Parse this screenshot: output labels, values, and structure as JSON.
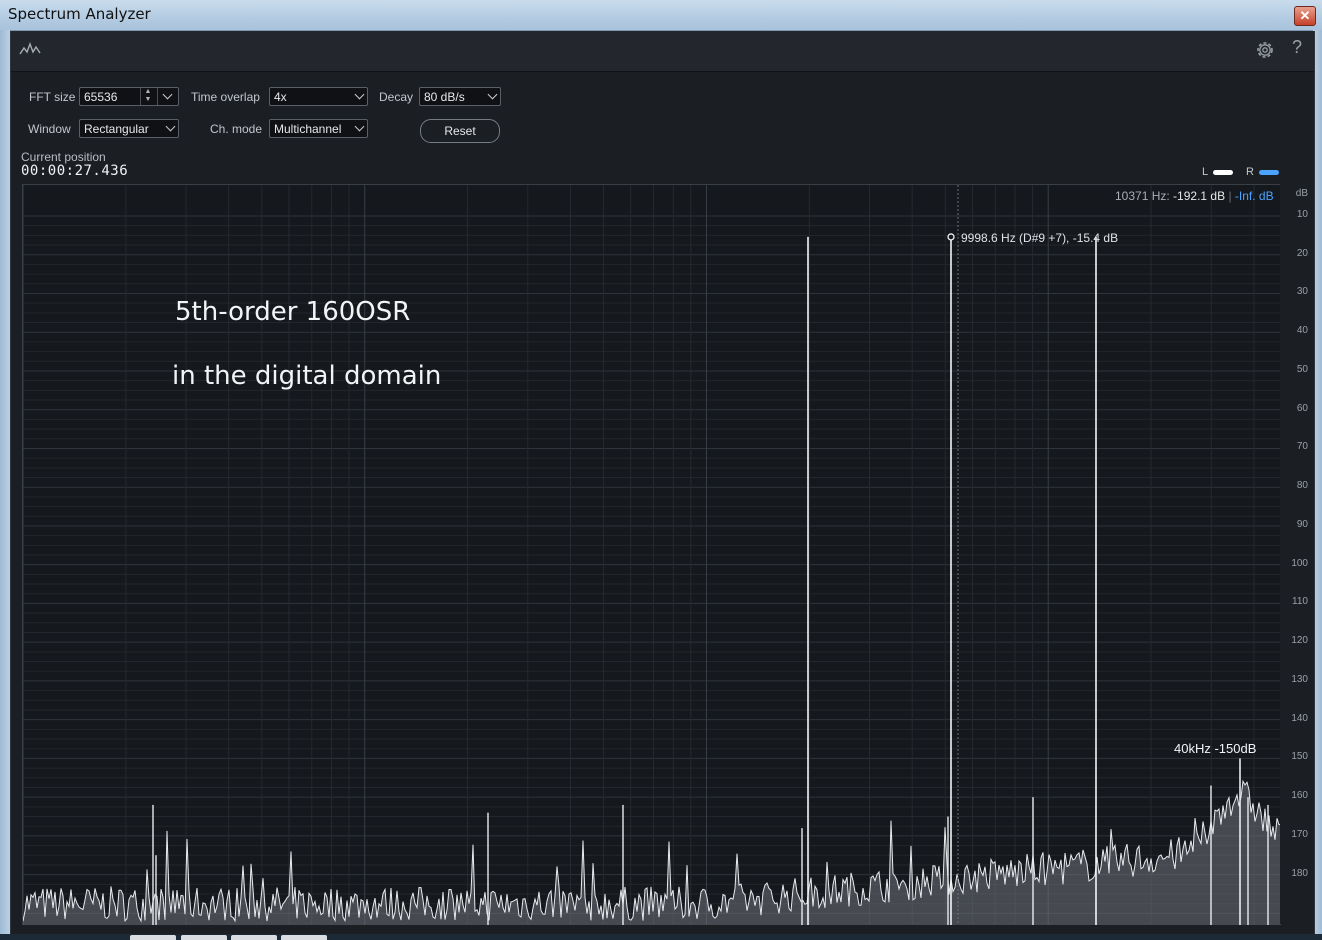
{
  "window": {
    "title": "Spectrum Analyzer",
    "close_glyph": "✕"
  },
  "toolbar": {
    "help_glyph": "?"
  },
  "controls": {
    "fft_size_label": "FFT size",
    "fft_size_value": "65536",
    "time_overlap_label": "Time overlap",
    "time_overlap_value": "4x",
    "decay_label": "Decay",
    "decay_value": "80 dB/s",
    "window_label": "Window",
    "window_value": "Rectangular",
    "ch_mode_label": "Ch. mode",
    "ch_mode_value": "Multichannel",
    "reset_label": "Reset"
  },
  "position": {
    "label": "Current position",
    "value": "00:00:27.436"
  },
  "legend": {
    "left_label": "L",
    "right_label": "R",
    "left_color": "#ffffff",
    "right_color": "#4aa3ff"
  },
  "readout": {
    "freq": "10371 Hz:",
    "left_db": "-192.1 dB",
    "separator": "|",
    "right_db": "-Inf. dB"
  },
  "y_axis": {
    "unit": "dB",
    "ticks": [
      "10",
      "20",
      "30",
      "40",
      "50",
      "60",
      "70",
      "80",
      "90",
      "100",
      "110",
      "120",
      "130",
      "140",
      "150",
      "160",
      "170",
      "180"
    ]
  },
  "annotations": {
    "peak": "9998.6 Hz (D#9 +7), -15.4 dB",
    "line1": "5th-order 160OSR",
    "line2": "in the digital domain",
    "note_40k": "40kHz -150dB"
  },
  "spectrum": {
    "tones": [
      {
        "label": "",
        "db": -15.4
      },
      {
        "label": "",
        "db": -15.4
      },
      {
        "label": "",
        "db": -15.4
      }
    ]
  }
}
